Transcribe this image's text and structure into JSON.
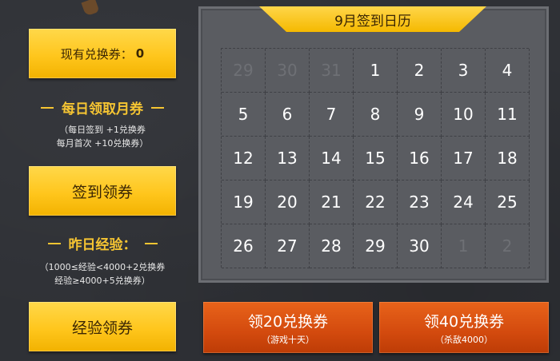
{
  "left_panel": {
    "voucher_label": "现有兑换券：",
    "voucher_count": "0",
    "daily_section_title": "每日领取月券",
    "daily_notes": [
      "（每日签到 +1兑换券",
      "每月首次 +10兑换券）"
    ],
    "signin_button": "签到领券",
    "exp_section_title": "昨日经验：",
    "exp_notes": [
      "（1000≤经验<4000+2兑换券",
      "经验≥4000+5兑换券）"
    ],
    "exp_button": "经验领券"
  },
  "calendar": {
    "title": "9月签到日历",
    "days": [
      {
        "label": "29",
        "in_month": false
      },
      {
        "label": "30",
        "in_month": false
      },
      {
        "label": "31",
        "in_month": false
      },
      {
        "label": "1",
        "in_month": true
      },
      {
        "label": "2",
        "in_month": true
      },
      {
        "label": "3",
        "in_month": true
      },
      {
        "label": "4",
        "in_month": true
      },
      {
        "label": "5",
        "in_month": true
      },
      {
        "label": "6",
        "in_month": true
      },
      {
        "label": "7",
        "in_month": true
      },
      {
        "label": "8",
        "in_month": true
      },
      {
        "label": "9",
        "in_month": true
      },
      {
        "label": "10",
        "in_month": true
      },
      {
        "label": "11",
        "in_month": true
      },
      {
        "label": "12",
        "in_month": true
      },
      {
        "label": "13",
        "in_month": true
      },
      {
        "label": "14",
        "in_month": true
      },
      {
        "label": "15",
        "in_month": true
      },
      {
        "label": "16",
        "in_month": true
      },
      {
        "label": "17",
        "in_month": true
      },
      {
        "label": "18",
        "in_month": true
      },
      {
        "label": "19",
        "in_month": true
      },
      {
        "label": "20",
        "in_month": true
      },
      {
        "label": "21",
        "in_month": true
      },
      {
        "label": "22",
        "in_month": true
      },
      {
        "label": "23",
        "in_month": true
      },
      {
        "label": "24",
        "in_month": true
      },
      {
        "label": "25",
        "in_month": true
      },
      {
        "label": "26",
        "in_month": true
      },
      {
        "label": "27",
        "in_month": true
      },
      {
        "label": "28",
        "in_month": true
      },
      {
        "label": "29",
        "in_month": true
      },
      {
        "label": "30",
        "in_month": true
      },
      {
        "label": "1",
        "in_month": false
      },
      {
        "label": "2",
        "in_month": false
      }
    ]
  },
  "rewards": {
    "btn20_label": "领20兑换券",
    "btn20_sub": "（游戏十天）",
    "btn40_label": "领40兑换券",
    "btn40_sub": "（杀敌4000）"
  },
  "colors": {
    "accent_yellow": "#ffc61d",
    "accent_orange": "#d34a0e",
    "background": "#2f3136"
  }
}
